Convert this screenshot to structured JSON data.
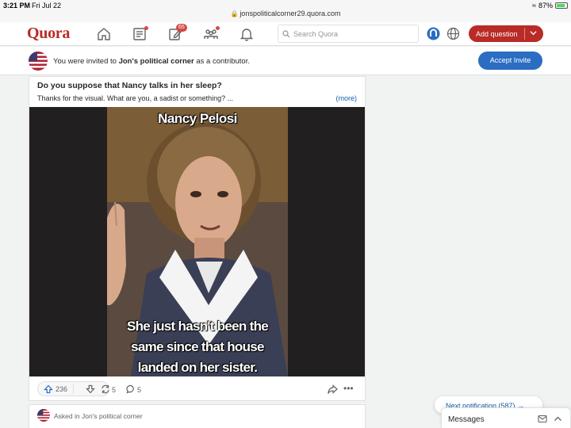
{
  "status_bar": {
    "time": "3:21 PM",
    "date": "Fri Jul 22",
    "battery": "87%",
    "url": "jonspoliticalcorner29.quora.com"
  },
  "header": {
    "logo": "Quora",
    "spaces_badge": "65",
    "search_placeholder": "Search Quora",
    "add_question_label": "Add question"
  },
  "invite": {
    "text_before": "You were invited to ",
    "space_name": "Jon's political corner",
    "text_after": " as a contributor.",
    "accept_label": "Accept Invite"
  },
  "post": {
    "title": "Do you suppose that Nancy talks in her sleep?",
    "snippet": "Thanks for the visual. What are you, a sadist or something? ...",
    "more_label": "(more)",
    "meme_top": "Nancy Pelosi",
    "meme_bottom_1": "She just hasn't been the",
    "meme_bottom_2": "same since that house",
    "meme_bottom_3": "landed on her sister.",
    "upvotes": "236",
    "shares": "5",
    "comments": "5"
  },
  "second_post": {
    "asked_in": "Asked in Jon's political corner"
  },
  "next_notification": "Next notification (587)",
  "messages_label": "Messages",
  "colors": {
    "brand": "#b92b27",
    "accent": "#2a6dc2",
    "badge": "#d14c42"
  }
}
